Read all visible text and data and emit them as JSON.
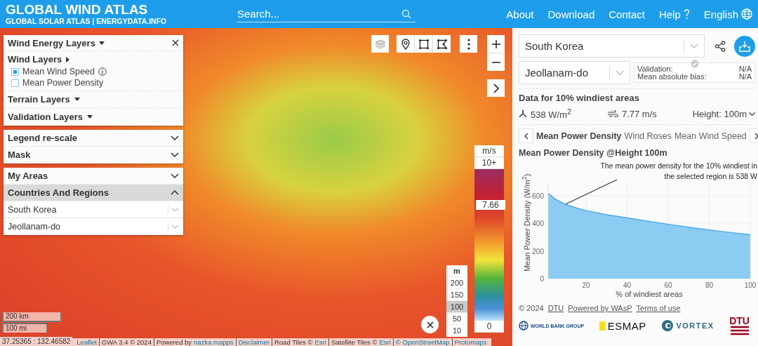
{
  "header": {
    "title": "GLOBAL WIND ATLAS",
    "subtitle": "GLOBAL SOLAR ATLAS | ENERGYDATA.INFO",
    "search": {
      "placeholder": "Search..."
    },
    "nav": [
      {
        "label": "About",
        "kind": "link"
      },
      {
        "label": "Download",
        "kind": "link"
      },
      {
        "label": "Contact",
        "kind": "link"
      },
      {
        "label": "Help",
        "kind": "help"
      },
      {
        "label": "English",
        "kind": "language"
      }
    ]
  },
  "layer_panel": {
    "title": "Wind Energy Layers",
    "sections": [
      {
        "title": "Wind Layers",
        "kind": "submenu",
        "items": [
          {
            "label": "Mean Wind Speed",
            "checked": true,
            "info": true
          },
          {
            "label": "Mean Power Density",
            "checked": false,
            "info": false
          }
        ]
      },
      {
        "title": "Terrain Layers",
        "kind": "dropdown"
      },
      {
        "title": "Validation Layers",
        "kind": "dropdown"
      }
    ]
  },
  "accordions": [
    [
      {
        "title": "Legend re-scale",
        "expanded": false
      },
      {
        "title": "Mask",
        "expanded": false
      }
    ],
    [
      {
        "title": "My Areas",
        "expanded": false
      },
      {
        "title": "Countries And Regions",
        "expanded": true,
        "selects": [
          "South Korea",
          "Jeollanam-do"
        ]
      }
    ]
  ],
  "map": {
    "speed_legend": {
      "unit": "m/s",
      "max": "10+",
      "min": "0",
      "marker": {
        "value": "7.66",
        "level": 0.766
      }
    },
    "height_legend": {
      "unit": "m",
      "options": [
        {
          "label": "200",
          "selected": false
        },
        {
          "label": "150",
          "selected": false
        },
        {
          "label": "100",
          "selected": true
        },
        {
          "label": "50",
          "selected": false
        },
        {
          "label": "10",
          "selected": false
        }
      ]
    },
    "scale": {
      "metric": "200 km",
      "imperial": "100 mi"
    },
    "coordinates": "37.25365 : 132.46582",
    "attribution": [
      {
        "link": "Leaflet"
      },
      {
        "prefix": "GWA 3.4 © 2024"
      },
      {
        "prefix": "Powered by",
        "link": "nazka mapps"
      },
      {
        "link": "Disclaimer"
      },
      {
        "prefix": "Road Tiles ©",
        "link": "Esri"
      },
      {
        "prefix": "Satellite Tiles ©",
        "link": "Esri"
      },
      {
        "link": "© OpenStreetMap"
      },
      {
        "link": "Protomaps"
      }
    ]
  },
  "side": {
    "country": "South Korea",
    "region": "Jeollanam-do",
    "validation": [
      {
        "label": "Validation:",
        "value": "N/A"
      },
      {
        "label": "Mean absolute bias:",
        "value": "N/A"
      }
    ],
    "data_title": "Data for 10% windiest areas",
    "power": "538 W/m$^{2}$",
    "speed": "7.77 m/s",
    "height": "Height: 100m",
    "tabs": [
      {
        "label": "Mean Power Density",
        "selected": true
      },
      {
        "label": "Wind Roses",
        "selected": false
      },
      {
        "label": "Mean Wind Speed",
        "selected": false
      }
    ],
    "chart_title": "Mean Power Density @Height 100m",
    "chart_data": {
      "type": "area",
      "xlabel": "% of windiest areas",
      "ylabel": "Mean Power Density (W/m$^{2}$)",
      "x": [
        1.5,
        5,
        10,
        15,
        20,
        30,
        40,
        50,
        60,
        70,
        80,
        90,
        100
      ],
      "series": [
        {
          "color": "#8ccbf2",
          "values": [
            618,
            575,
            538,
            512,
            492,
            462,
            440,
            415,
            393,
            372,
            352,
            335,
            318
          ]
        }
      ],
      "grid": true,
      "xlim": [
        1.5,
        100
      ],
      "ylim": [
        0,
        690
      ],
      "xticks": [
        20,
        40,
        60,
        80,
        100
      ],
      "yticks": [
        0,
        200,
        400,
        600
      ],
      "annotations": [
        {
          "text": "The mean power density for the 10% windiest in the selected region is 538 W",
          "x": 10,
          "y": 538
        }
      ]
    },
    "footer": [
      {
        "text": "© 2024",
        "link": false
      },
      {
        "text": "DTU",
        "link": true
      },
      {
        "text": "Powered by WAsP",
        "link": true
      },
      {
        "text": "Terms of use",
        "link": true
      }
    ],
    "logos": [
      {
        "kind": "world_bank",
        "text": "WORLD BANK GROUP"
      },
      {
        "kind": "esmap",
        "text": "ESMAP"
      },
      {
        "kind": "vortex",
        "text": "VORTEX"
      },
      {
        "kind": "dtu",
        "text": "DTU"
      }
    ]
  }
}
